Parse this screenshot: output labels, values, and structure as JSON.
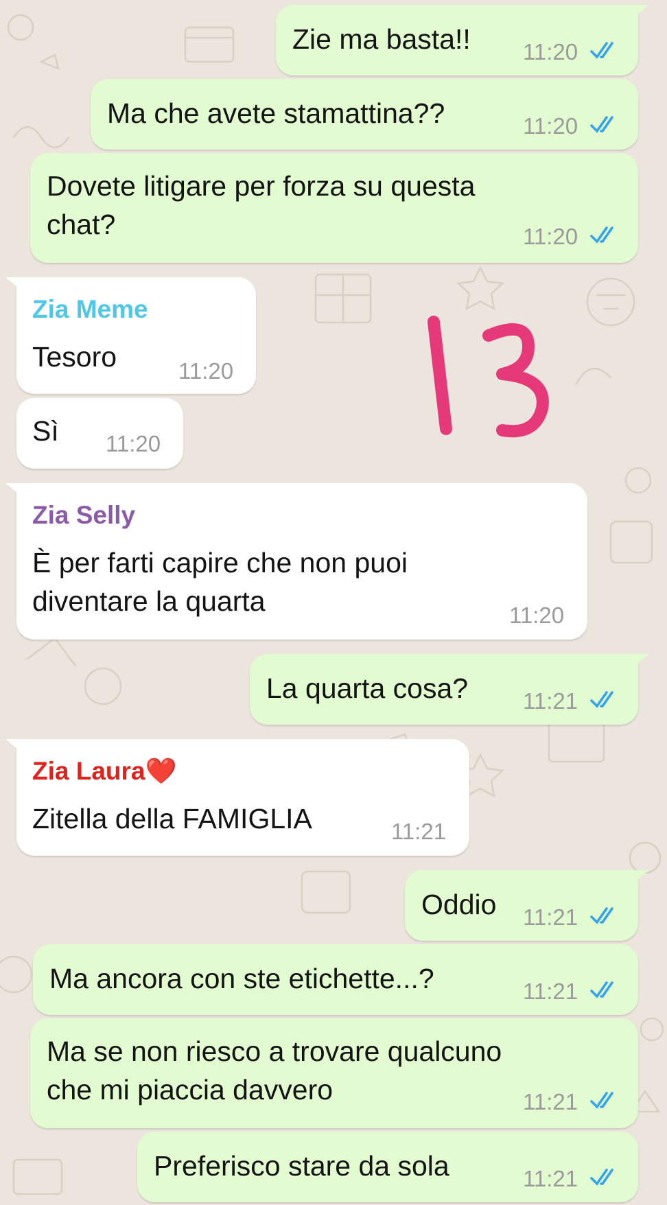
{
  "messages": [
    {
      "direction": "out",
      "text": "Zie ma basta!!",
      "time": "11:20",
      "status": "read"
    },
    {
      "direction": "out",
      "text": "Ma che avete stamattina??",
      "time": "11:20",
      "status": "read"
    },
    {
      "direction": "out",
      "text": "Dovete litigare per forza su questa\nchat?",
      "time": "11:20",
      "status": "read"
    },
    {
      "direction": "in",
      "sender": "Zia Meme",
      "sender_color": "#4fc8e8",
      "text": "Tesoro",
      "time": "11:20"
    },
    {
      "direction": "in",
      "text": "Sì",
      "time": "11:20"
    },
    {
      "direction": "in",
      "sender": "Zia Selly",
      "sender_color": "#8c5ba8",
      "text": "È per farti capire che non puoi\ndiventare la quarta",
      "time": "11:20"
    },
    {
      "direction": "out",
      "text": "La quarta cosa?",
      "time": "11:21",
      "status": "read"
    },
    {
      "direction": "in",
      "sender": "Zia Laura❤️",
      "sender_color": "#e0221c",
      "text": "Zitella della FAMIGLIA",
      "time": "11:21"
    },
    {
      "direction": "out",
      "text": "Oddio",
      "time": "11:21",
      "status": "read"
    },
    {
      "direction": "out",
      "text": "Ma ancora con ste etichette...?",
      "time": "11:21",
      "status": "read"
    },
    {
      "direction": "out",
      "text": "Ma se non riesco a trovare qualcuno\nche mi piaccia davvero",
      "time": "11:21",
      "status": "read"
    },
    {
      "direction": "out",
      "text": "Preferisco stare da sola",
      "time": "11:21",
      "status": "read"
    }
  ],
  "sticker": {
    "text": "13",
    "color": "#e5397a"
  },
  "colors": {
    "outgoing_bubble": "#e2fbd0",
    "incoming_bubble": "#ffffff",
    "read_ticks": "#34a4e8",
    "background": "#ece5dd"
  }
}
